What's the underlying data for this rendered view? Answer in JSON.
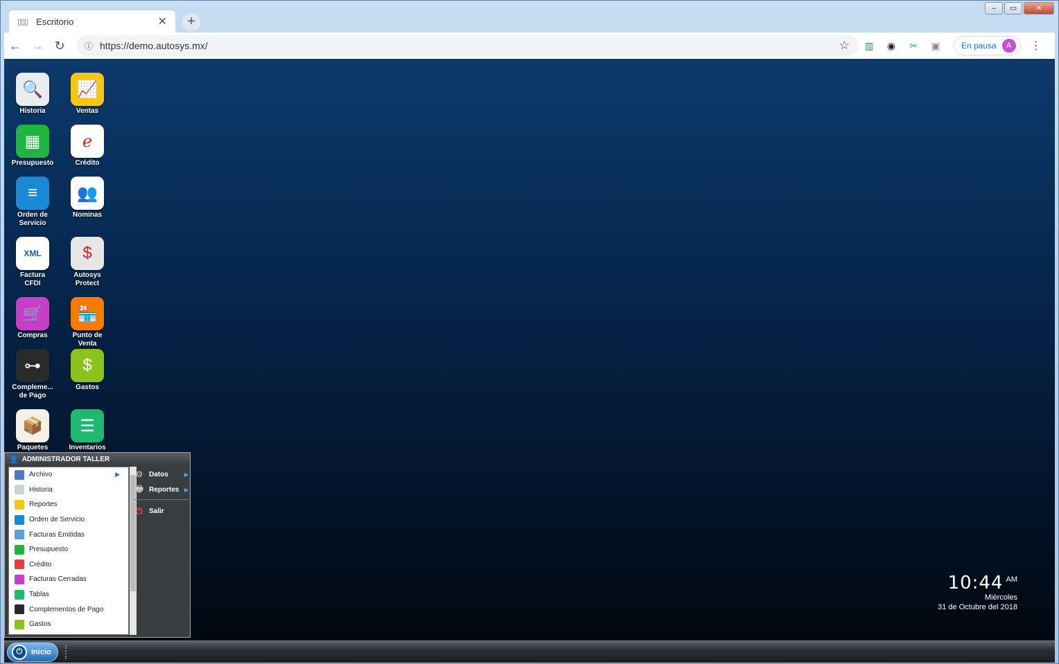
{
  "browser": {
    "tab_title": "Escritorio",
    "url": "https://demo.autosys.mx/",
    "profile_status": "En pausa",
    "profile_initial": "A"
  },
  "desktop_icons": [
    {
      "label": "Historia",
      "icon": "magnifier-icon",
      "color": "#e9edf0",
      "glyph": "🔍"
    },
    {
      "label": "Ventas",
      "icon": "line-chart-icon",
      "color": "#f5c518",
      "glyph": "📈"
    },
    {
      "label": "Presupuesto",
      "icon": "spreadsheet-icon",
      "color": "#1db440",
      "glyph": "▦"
    },
    {
      "label": "Crédito",
      "icon": "credit-icon",
      "color": "#ffffff",
      "glyph": "ℯ"
    },
    {
      "label": "Orden de\nServicio",
      "icon": "document-icon",
      "color": "#1b8ad6",
      "glyph": "≡"
    },
    {
      "label": "Nominas",
      "icon": "payroll-icon",
      "color": "#ffffff",
      "glyph": "👥"
    },
    {
      "label": "Factura\nCFDI",
      "icon": "xml-invoice-icon",
      "color": "#ffffff",
      "glyph": "XML"
    },
    {
      "label": "Autosys\nProtect",
      "icon": "protect-icon",
      "color": "#e6e6e6",
      "glyph": "$"
    },
    {
      "label": "Compras",
      "icon": "cart-icon",
      "color": "#c73fc7",
      "glyph": "🛒"
    },
    {
      "label": "Punto de\nVenta",
      "icon": "store-icon",
      "color": "#f57c00",
      "glyph": "🏪"
    },
    {
      "label": "Compleme...\nde Pago",
      "icon": "payment-complement-icon",
      "color": "#2a2a2a",
      "glyph": "⊶"
    },
    {
      "label": "Gastos",
      "icon": "coins-icon",
      "color": "#8cc21d",
      "glyph": "$"
    },
    {
      "label": "Paquetes",
      "icon": "package-icon",
      "color": "#f5f0e6",
      "glyph": "📦"
    },
    {
      "label": "Inventarios",
      "icon": "list-icon",
      "color": "#1fb870",
      "glyph": "☰"
    }
  ],
  "start_menu": {
    "user": "ADMINISTRADOR TALLER",
    "left_items": [
      {
        "label": "Archivo",
        "icon": "archive-icon",
        "color": "#4a7cc4",
        "has_submenu": true
      },
      {
        "label": "Historia",
        "icon": "magnifier-icon",
        "color": "#cfd4d8",
        "has_submenu": false
      },
      {
        "label": "Reportes",
        "icon": "line-chart-icon",
        "color": "#f5c518",
        "has_submenu": false
      },
      {
        "label": "Orden de Servicio",
        "icon": "document-icon",
        "color": "#1b8ad6",
        "has_submenu": false
      },
      {
        "label": "Facturas Emitidas",
        "icon": "invoice-icon",
        "color": "#5aa1d6",
        "has_submenu": false
      },
      {
        "label": "Presupuesto",
        "icon": "spreadsheet-icon",
        "color": "#1db440",
        "has_submenu": false
      },
      {
        "label": "Crédito",
        "icon": "credit-icon",
        "color": "#e04040",
        "has_submenu": false
      },
      {
        "label": "Facturas Cerradas",
        "icon": "closed-invoice-icon",
        "color": "#c73fc7",
        "has_submenu": false
      },
      {
        "label": "Tablas",
        "icon": "table-icon",
        "color": "#1fb870",
        "has_submenu": false
      },
      {
        "label": "Complementos de Pago",
        "icon": "payment-complement-icon",
        "color": "#2a2a2a",
        "has_submenu": false
      },
      {
        "label": "Gastos",
        "icon": "coins-icon",
        "color": "#8cc21d",
        "has_submenu": false
      }
    ],
    "right_items": [
      {
        "label": "Datos",
        "icon": "gear-icon",
        "glyph": "⚙",
        "has_submenu": true
      },
      {
        "label": "Reportes",
        "icon": "printer-icon",
        "glyph": "🖶",
        "has_submenu": true
      },
      {
        "label": "Salir",
        "icon": "power-exit-icon",
        "glyph": "⏻",
        "has_submenu": false
      }
    ]
  },
  "clock": {
    "time": "10:44",
    "ampm": "AM",
    "day": "Miércoles",
    "date": "31 de Octubre del 2018"
  },
  "taskbar": {
    "start_label": "Inicio"
  }
}
